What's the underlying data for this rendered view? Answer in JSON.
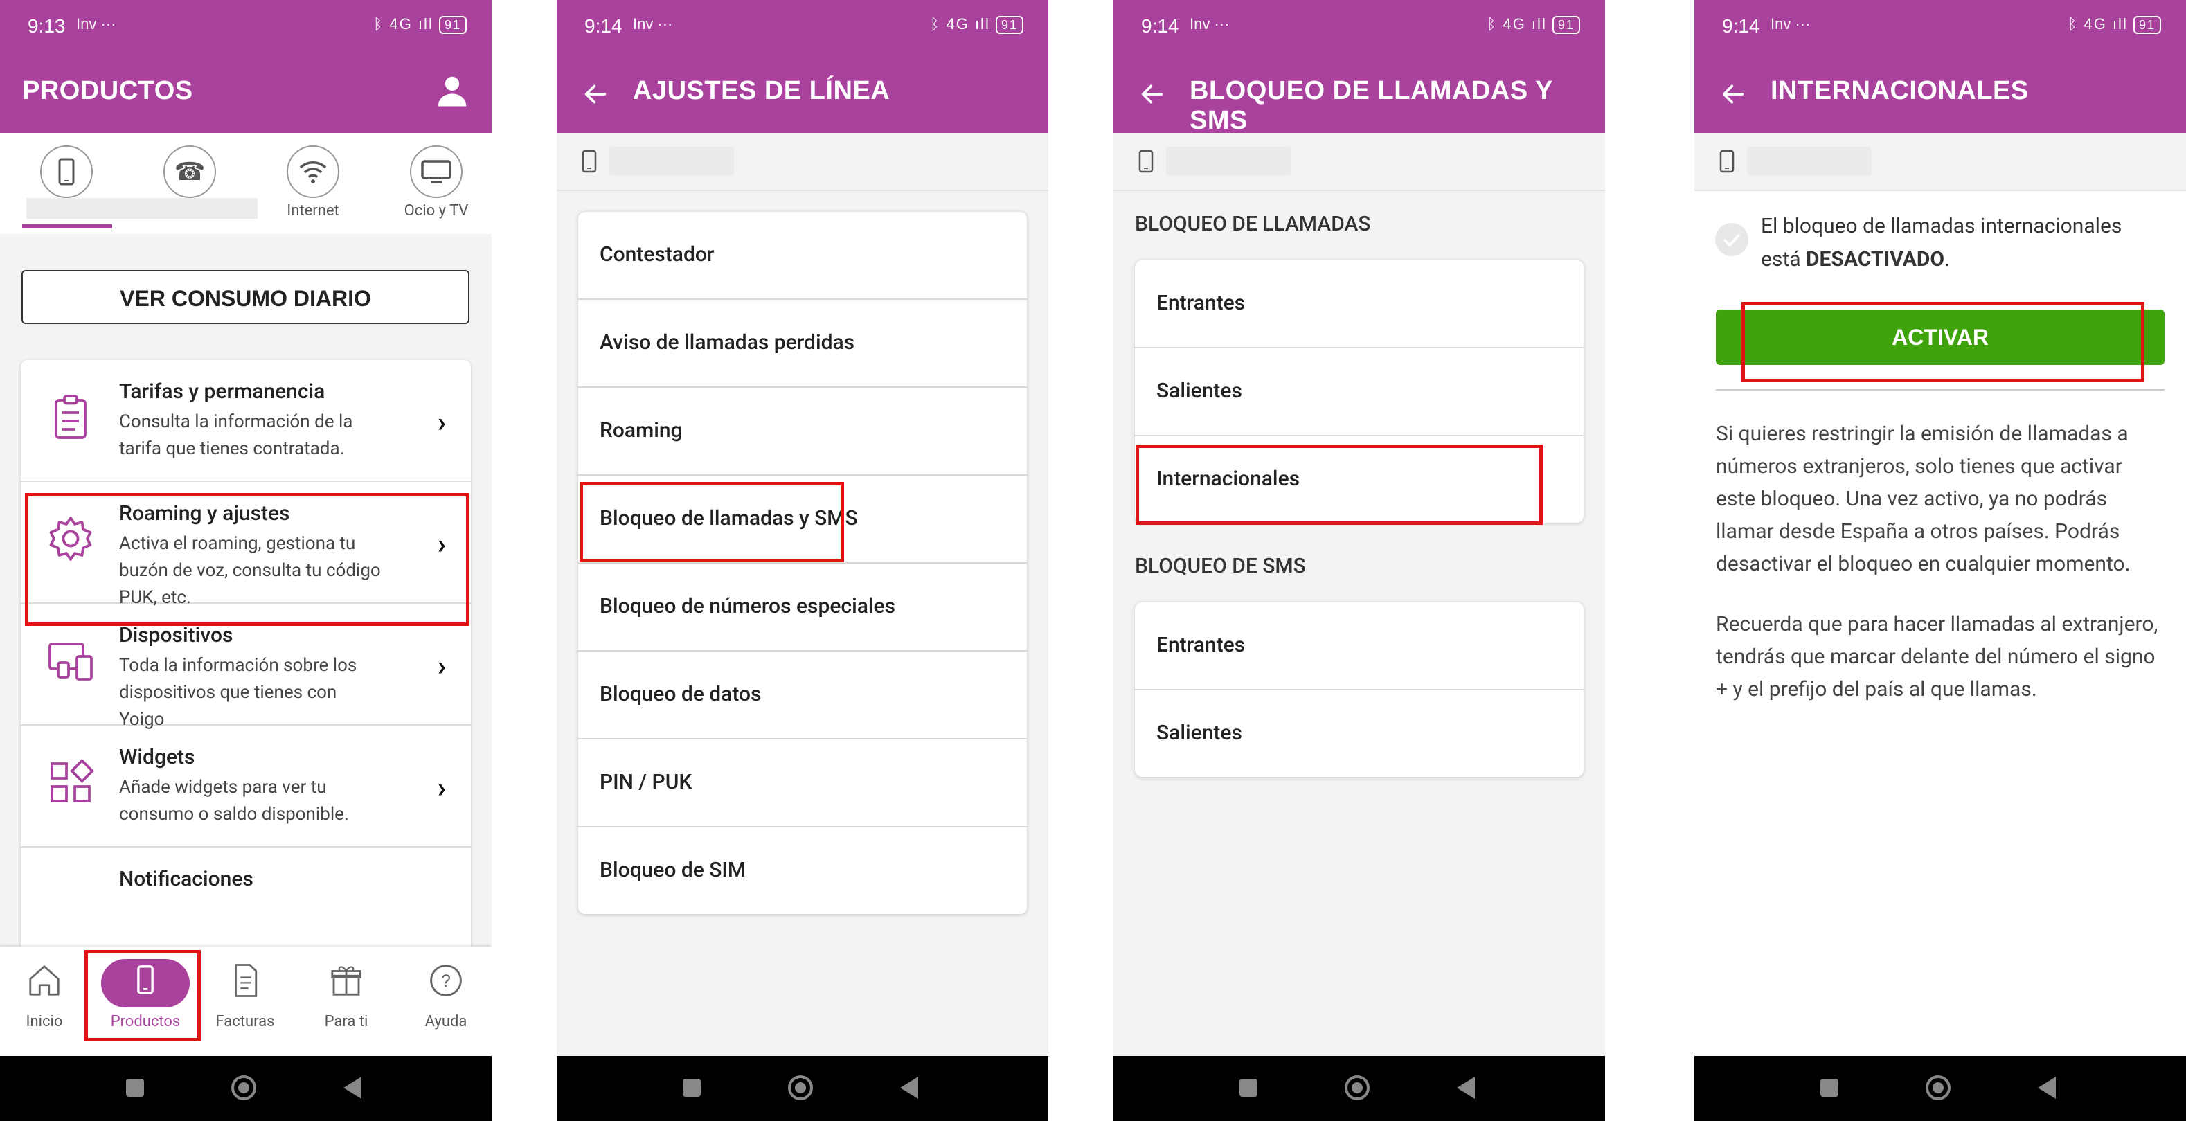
{
  "status": {
    "s1_time": "9:13",
    "time": "9:14",
    "apps": "Inv ···",
    "signal": "ᛒ 4G ıll",
    "battery": "91"
  },
  "screen1": {
    "title": "PRODUCTOS",
    "tabs": [
      "",
      "",
      "Internet",
      "Ocio y TV"
    ],
    "ver_consumo": "VER CONSUMO DIARIO",
    "items": [
      {
        "title": "Tarifas y permanencia",
        "desc": "Consulta la información de la tarifa que tienes contratada."
      },
      {
        "title": "Roaming y ajustes",
        "desc": "Activa el roaming, gestiona tu buzón de voz, consulta tu código PUK, etc."
      },
      {
        "title": "Dispositivos",
        "desc": "Toda la información sobre los dispositivos que tienes con Yoigo"
      },
      {
        "title": "Widgets",
        "desc": "Añade widgets para ver tu consumo o saldo disponible."
      },
      {
        "title": "Notificaciones",
        "desc": ""
      }
    ],
    "bottom_tabs": [
      "Inicio",
      "Productos",
      "Facturas",
      "Para ti",
      "Ayuda"
    ]
  },
  "screen2": {
    "title": "AJUSTES DE LÍNEA",
    "items": [
      "Contestador",
      "Aviso de llamadas perdidas",
      "Roaming",
      "Bloqueo de llamadas y SMS",
      "Bloqueo de números especiales",
      "Bloqueo de datos",
      "PIN / PUK",
      "Bloqueo de SIM"
    ]
  },
  "screen3": {
    "title": "BLOQUEO DE LLAMADAS Y SMS",
    "section_calls": "BLOQUEO DE LLAMADAS",
    "calls": [
      "Entrantes",
      "Salientes",
      "Internacionales"
    ],
    "section_sms": "BLOQUEO DE SMS",
    "sms": [
      "Entrantes",
      "Salientes"
    ]
  },
  "screen4": {
    "title": "INTERNACIONALES",
    "status_prefix": "El bloqueo de llamadas internacionales está ",
    "status_value": "DESACTIVADO",
    "status_suffix": ".",
    "button": "ACTIVAR",
    "para1": "Si quieres restringir la emisión de llamadas a números extranjeros, solo tienes que activar este bloqueo. Una vez activo, ya no podrás llamar desde España a otros países. Podrás desactivar el bloqueo en cualquier momento.",
    "para2": "Recuerda que para hacer llamadas al extranjero, tendrás que marcar delante del número el signo + y el prefijo del país al que llamas."
  },
  "colors": {
    "brand": "#a8429c",
    "activate": "#3fa30b",
    "highlight": "#e01414"
  }
}
